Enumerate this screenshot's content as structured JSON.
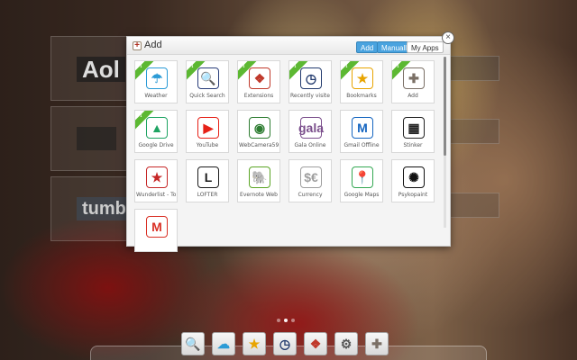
{
  "dialog": {
    "title": "Add",
    "tabs": {
      "add": "Add",
      "manually": "Manually",
      "my_apps": "My Apps"
    },
    "close_glyph": "×",
    "apps": [
      {
        "label": "Weather",
        "icon": "weather-icon",
        "glyph": "☂",
        "color": "#2b9bd6",
        "installed": true
      },
      {
        "label": "Quick Search",
        "icon": "search-icon",
        "glyph": "🔍",
        "color": "#2a3e7a",
        "installed": true
      },
      {
        "label": "Extensions",
        "icon": "dropbox-icon",
        "glyph": "❖",
        "color": "#c0392b",
        "installed": true
      },
      {
        "label": "Recently visited",
        "icon": "clock-icon",
        "glyph": "◷",
        "color": "#233b6e",
        "installed": true
      },
      {
        "label": "Bookmarks",
        "icon": "star-icon",
        "glyph": "★",
        "color": "#e8a400",
        "installed": true
      },
      {
        "label": "Add",
        "icon": "plus-icon",
        "glyph": "✚",
        "color": "#7a6f65",
        "installed": true
      },
      {
        "label": "Google Drive",
        "icon": "google-drive-icon",
        "glyph": "▲",
        "color": "#1fa463",
        "installed": true
      },
      {
        "label": "YouTube",
        "icon": "youtube-icon",
        "glyph": "▶",
        "color": "#e62117",
        "installed": false
      },
      {
        "label": "WebCamera59",
        "icon": "webcam-icon",
        "glyph": "◉",
        "color": "#2e7d32",
        "installed": false
      },
      {
        "label": "Gala Online",
        "icon": "gala-icon",
        "glyph": "gala",
        "color": "#7b4f8c",
        "installed": false
      },
      {
        "label": "Gmail Offline",
        "icon": "gmail-offline-icon",
        "glyph": "M",
        "color": "#1565c0",
        "installed": false
      },
      {
        "label": "Stinker",
        "icon": "stinker-icon",
        "glyph": "▦",
        "color": "#222222",
        "installed": false
      },
      {
        "label": "Wunderlist - To",
        "icon": "wunderlist-icon",
        "glyph": "★",
        "color": "#c62828",
        "installed": false
      },
      {
        "label": "LOFTER",
        "icon": "lofter-icon",
        "glyph": "L",
        "color": "#1b1b1b",
        "installed": false
      },
      {
        "label": "Evernote Web",
        "icon": "evernote-icon",
        "glyph": "🐘",
        "color": "#5ba525",
        "installed": false
      },
      {
        "label": "Currency",
        "icon": "currency-icon",
        "glyph": "$€",
        "color": "#9e9e9e",
        "installed": false
      },
      {
        "label": "Google Maps",
        "icon": "google-maps-icon",
        "glyph": "📍",
        "color": "#34a853",
        "installed": false
      },
      {
        "label": "Psykopaint",
        "icon": "psykopaint-icon",
        "glyph": "✺",
        "color": "#111111",
        "installed": false
      },
      {
        "label": "",
        "icon": "gmail-icon",
        "glyph": "M",
        "color": "#d93025",
        "installed": false
      }
    ]
  },
  "background_dials": [
    {
      "name": "aol-dial",
      "label": "Aol"
    },
    {
      "name": "apple-dial",
      "label": ""
    },
    {
      "name": "tumblr-dial",
      "label": "tumblr."
    }
  ],
  "pager": {
    "pages": 3,
    "active": 1
  },
  "dock": [
    {
      "name": "dock-quick-search",
      "icon": "search-icon",
      "glyph": "🔍",
      "color": "#2a3e7a"
    },
    {
      "name": "dock-weather",
      "icon": "weather-icon",
      "glyph": "☁",
      "color": "#2b9bd6"
    },
    {
      "name": "dock-bookmarks",
      "icon": "star-icon",
      "glyph": "★",
      "color": "#e8a400"
    },
    {
      "name": "dock-recently-visited",
      "icon": "clock-icon",
      "glyph": "◷",
      "color": "#233b6e"
    },
    {
      "name": "dock-extensions",
      "icon": "dropbox-icon",
      "glyph": "❖",
      "color": "#c0392b"
    },
    {
      "name": "dock-settings",
      "icon": "gear-icon",
      "glyph": "⚙",
      "color": "#555555"
    },
    {
      "name": "dock-add",
      "icon": "plus-icon",
      "glyph": "✚",
      "color": "#7a6f65"
    }
  ]
}
